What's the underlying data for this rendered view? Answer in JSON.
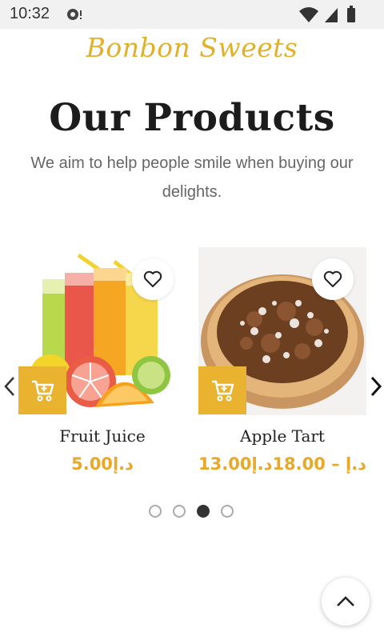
{
  "status_bar": {
    "time": "10:32"
  },
  "brand": {
    "name": "Bonbon Sweets"
  },
  "section": {
    "title": "Our Products",
    "subtitle": "We aim to help people smile when buying our delights."
  },
  "products": [
    {
      "name": "Fruit Juice",
      "price": "5.00د.إ"
    },
    {
      "name": "Apple Tart",
      "price": "13.00د.إ – 18.00د.إ"
    }
  ],
  "carousel": {
    "pages": 4,
    "active_index": 2
  },
  "colors": {
    "accent": "#e9b22f",
    "brand": "#e1b12c",
    "price": "#e9a82a"
  }
}
